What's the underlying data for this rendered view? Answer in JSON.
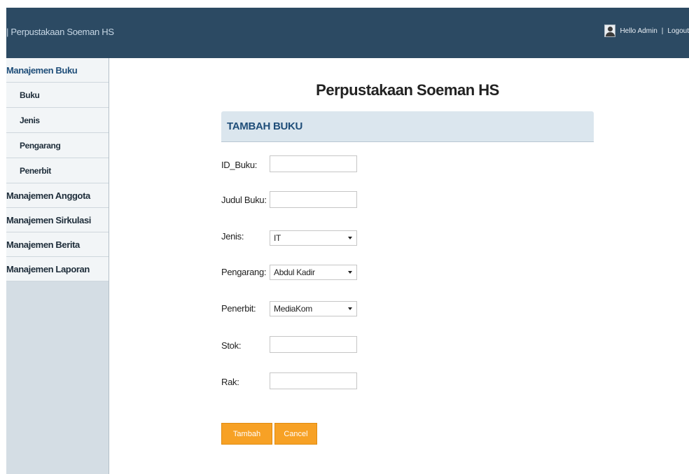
{
  "header": {
    "brand": "| Perpustakaan Soeman HS",
    "greeting": "Hello Admin",
    "separator": "|",
    "logout": "Logout"
  },
  "sidebar": {
    "sections": [
      {
        "label": "Manajemen Buku",
        "sub": [
          "Buku",
          "Jenis",
          "Pengarang",
          "Penerbit"
        ]
      },
      {
        "label": "Manajemen Anggota"
      },
      {
        "label": "Manajemen Sirkulasi"
      },
      {
        "label": "Manajemen Berita"
      },
      {
        "label": "Manajemen Laporan"
      }
    ]
  },
  "main": {
    "title": "Perpustakaan Soeman HS",
    "panel_title": "TAMBAH BUKU"
  },
  "form": {
    "id_buku": {
      "label": "ID_Buku:",
      "value": ""
    },
    "judul_buku": {
      "label": "Judul Buku:",
      "value": ""
    },
    "jenis": {
      "label": "Jenis:",
      "selected": "IT"
    },
    "pengarang": {
      "label": "Pengarang:",
      "selected": "Abdul Kadir"
    },
    "penerbit": {
      "label": "Penerbit:",
      "selected": "MediaKom"
    },
    "stok": {
      "label": "Stok:",
      "value": ""
    },
    "rak": {
      "label": "Rak:",
      "value": ""
    },
    "submit_label": "Tambah",
    "cancel_label": "Cancel"
  },
  "colors": {
    "header_bg": "#2c4a63",
    "sidebar_bg": "#d4dde4",
    "accent": "#1f4e79",
    "button": "#f7a125"
  },
  "icons": {
    "user": "user-avatar-icon",
    "dropdown": "chevron-down-icon"
  }
}
